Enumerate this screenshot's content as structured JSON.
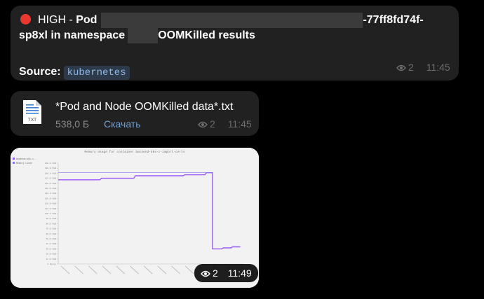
{
  "messages": [
    {
      "type": "alert",
      "severity": "HIGH",
      "severity_sep": " - ",
      "title_prefix": "Pod",
      "title_suffix": "-77ff8fd74f-",
      "line2_start": "sp8xl in namespace",
      "line2_end": "OOMKilled results",
      "source_label": "Source:",
      "source_value": "kubernetes",
      "views": "2",
      "time": "11:45"
    },
    {
      "type": "file",
      "file_name": "*Pod and Node OOMKilled data*.txt",
      "file_ext": "TXT",
      "file_size": "538,0 Б",
      "download_label": "Скачать",
      "views": "2",
      "time": "11:45"
    },
    {
      "type": "image",
      "views": "2",
      "time": "11:49"
    }
  ],
  "colors": {
    "bubble": "#212121",
    "alert_dot": "#e8382f",
    "link": "#6ea2d8",
    "series": "#9b59f6",
    "limit": "#7f77e8"
  },
  "chart_data": {
    "type": "line",
    "title": "Memory Usage for container backend-k8s-c-import-certs",
    "legend": [
      "backend-k8s-c...",
      "Memory Limit"
    ],
    "y_ticks": [
      "200.0 MiB",
      "190.0 MiB",
      "180.0 MiB",
      "170.0 MiB",
      "160.0 MiB",
      "150.0 MiB",
      "140.0 MiB",
      "130.0 MiB",
      "120.0 MiB",
      "110.0 MiB",
      "100.0 MiB",
      "90.0 MiB",
      "80.0 MiB",
      "70.0 MiB",
      "60.0 MiB",
      "50.0 MiB",
      "40.0 MiB",
      "30.0 MiB",
      "20.0 MiB",
      "10.0 MiB",
      "0 Bytes"
    ],
    "ylim": [
      0,
      200
    ],
    "series": [
      {
        "name": "backend-k8s-c...",
        "x": [
          0,
          0.27,
          0.28,
          0.49,
          0.5,
          0.81,
          0.82,
          0.95,
          0.96,
          0.97,
          1.0,
          1.0,
          1.06,
          1.07,
          1.12,
          1.13,
          1.18
        ],
        "y": [
          167,
          167,
          170,
          170,
          175,
          175,
          177,
          177,
          181,
          181,
          181,
          30,
          30,
          32,
          32,
          34,
          34
        ]
      },
      {
        "name": "Memory Limit",
        "x": [
          0,
          1.0
        ],
        "y": [
          181,
          181
        ]
      }
    ]
  }
}
